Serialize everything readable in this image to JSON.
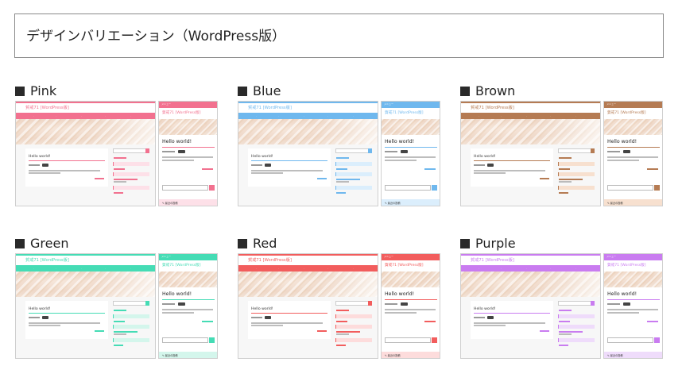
{
  "page": {
    "title": "デザインバリエーション（WordPress版）"
  },
  "preview": {
    "site_title": "賀戒71 [WordPress版]",
    "menu_label": "メニュー",
    "post_heading": "Hello world!",
    "recent_posts_label": "最近の投稿"
  },
  "variants": [
    {
      "name": "Pink",
      "accent": "#f2718f",
      "light": "#fde0e8"
    },
    {
      "name": "Blue",
      "accent": "#6fb8ee",
      "light": "#dbeefc"
    },
    {
      "name": "Brown",
      "accent": "#b57b53",
      "light": "#f7e0cf"
    },
    {
      "name": "Green",
      "accent": "#45dcb5",
      "light": "#d4f6ec"
    },
    {
      "name": "Red",
      "accent": "#f25d5d",
      "light": "#fddcdc"
    },
    {
      "name": "Purple",
      "accent": "#c97cf0",
      "light": "#efdcfb"
    }
  ]
}
